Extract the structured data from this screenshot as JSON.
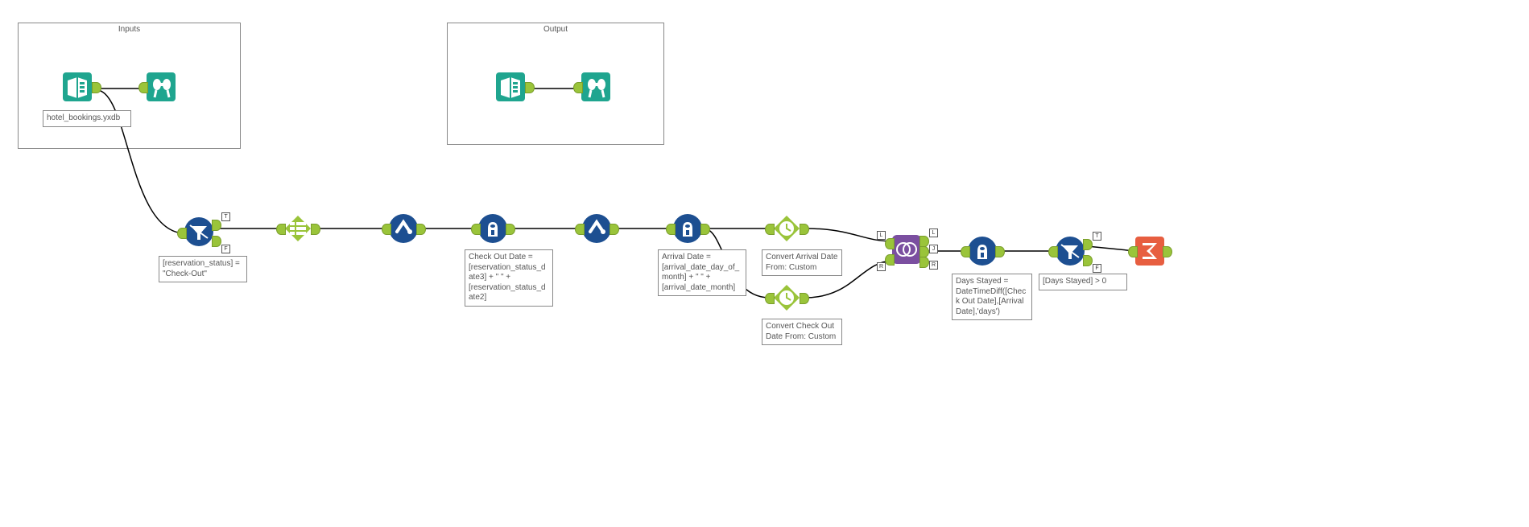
{
  "containers": {
    "inputs_title": "Inputs",
    "output_title": "Output"
  },
  "labels": {
    "input_file": "hotel_bookings.yxdb",
    "filter1": "[reservation_status] = \"Check-Out\"",
    "formula1": "Check Out Date = [reservation_status_date3] + \" \" + [reservation_status_date2]",
    "formula2": "Arrival Date = [arrival_date_day_of_month] + \" \" + [arrival_date_month]",
    "datetime1": "Convert Arrival Date From: Custom",
    "datetime2": "Convert Check Out Date From: Custom",
    "formula3": "Days Stayed = DateTimeDiff([Check Out Date],[Arrival Date],'days')",
    "filter2": "[Days Stayed]  > 0"
  },
  "tags": {
    "t": "T",
    "f": "F",
    "l": "L",
    "j": "J",
    "r": "R"
  }
}
